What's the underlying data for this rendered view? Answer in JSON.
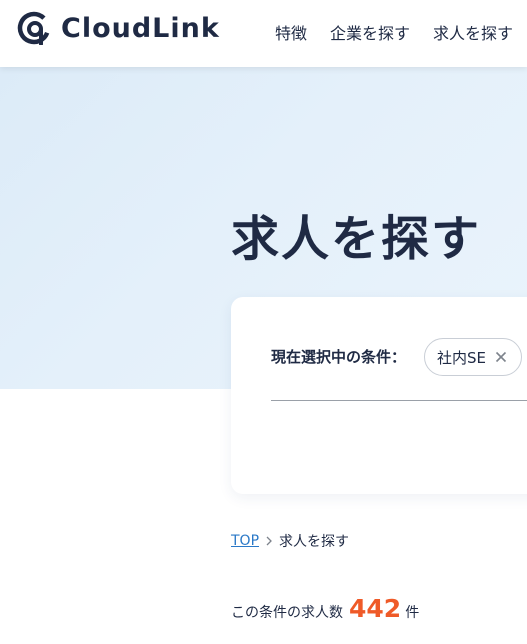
{
  "header": {
    "logo_text": "CloudLink",
    "nav": [
      "特徴",
      "企業を探す",
      "求人を探す"
    ]
  },
  "hero": {
    "title": "求人を探す"
  },
  "conditions": {
    "label": "現在選択中の条件：",
    "chips": [
      "社内SE"
    ]
  },
  "breadcrumb": {
    "top": "TOP",
    "current": "求人を探す"
  },
  "results": {
    "label": "この条件の求人数",
    "count": "442",
    "unit": "件"
  },
  "colors": {
    "accent": "#ef5a28",
    "link": "#2a78c7",
    "navy": "#1f2a44"
  }
}
